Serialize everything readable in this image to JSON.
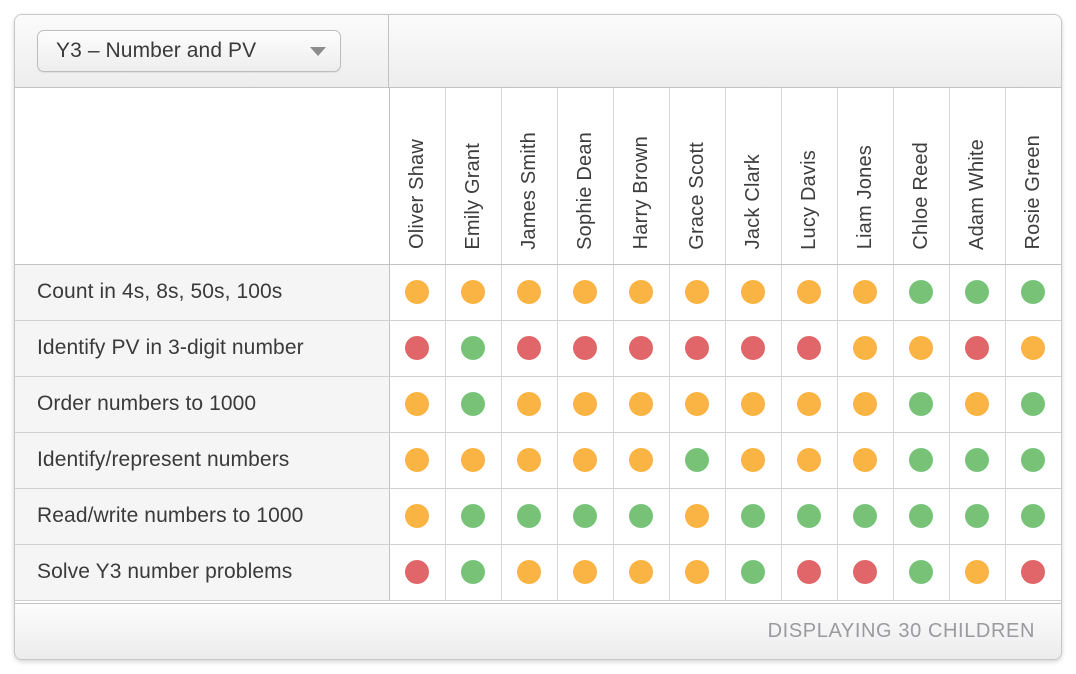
{
  "toolbar": {
    "dropdown": {
      "label": "Y3 – Number and PV",
      "caret_icon": "chevron-down-icon"
    }
  },
  "grid": {
    "corner_label": "",
    "students": [
      "Oliver Shaw",
      "Emily Grant",
      "James Smith",
      "Sophie Dean",
      "Harry Brown",
      "Grace Scott",
      "Jack Clark",
      "Lucy Davis",
      "Liam Jones",
      "Chloe Reed",
      "Adam White",
      "Rosie Green"
    ],
    "objectives": [
      "Count in 4s, 8s, 50s, 100s",
      "Identify PV in 3-digit number",
      "Order numbers to 1000",
      "Identify/represent numbers",
      "Read/write numbers to 1000",
      "Solve Y3 number problems"
    ],
    "statuses": [
      [
        "amber",
        "amber",
        "amber",
        "amber",
        "amber",
        "amber",
        "amber",
        "amber",
        "amber",
        "green",
        "green",
        "green"
      ],
      [
        "red",
        "green",
        "red",
        "red",
        "red",
        "red",
        "red",
        "red",
        "amber",
        "amber",
        "red",
        "amber"
      ],
      [
        "amber",
        "green",
        "amber",
        "amber",
        "amber",
        "amber",
        "amber",
        "amber",
        "amber",
        "green",
        "amber",
        "green"
      ],
      [
        "amber",
        "amber",
        "amber",
        "amber",
        "amber",
        "green",
        "amber",
        "amber",
        "amber",
        "green",
        "green",
        "green"
      ],
      [
        "amber",
        "green",
        "green",
        "green",
        "green",
        "amber",
        "green",
        "green",
        "green",
        "green",
        "green",
        "green"
      ],
      [
        "red",
        "green",
        "amber",
        "amber",
        "amber",
        "amber",
        "green",
        "red",
        "red",
        "green",
        "amber",
        "red"
      ]
    ],
    "status_colors": {
      "green": "#77c276",
      "amber": "#f9b443",
      "red": "#e0666a"
    }
  },
  "footer": {
    "count_text": "DISPLAYING 30 CHILDREN"
  }
}
